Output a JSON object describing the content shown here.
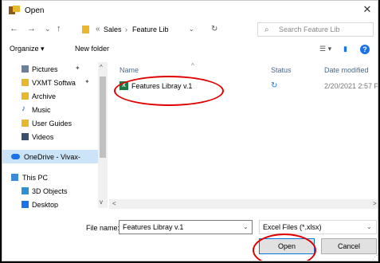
{
  "window": {
    "title": "Open",
    "close": "✕"
  },
  "nav_buttons": {
    "back": "←",
    "forward": "→",
    "dropdown": "⌄",
    "up": "↑",
    "refresh": "↻"
  },
  "address": {
    "overflow": "«",
    "crumbs": [
      "Sales",
      "Feature Lib"
    ],
    "separator": "›"
  },
  "search": {
    "placeholder": "Search Feature Lib"
  },
  "toolbar": {
    "organize": "Organize ▾",
    "new_folder": "New folder"
  },
  "sidebar": {
    "items": [
      {
        "label": "Pictures",
        "pinned": true,
        "icon": "pictures-icon"
      },
      {
        "label": "VXMT Softwa",
        "pinned": true,
        "icon": "folder-icon"
      },
      {
        "label": "Archive",
        "pinned": false,
        "icon": "folder-icon"
      },
      {
        "label": "Music",
        "pinned": false,
        "icon": "music-icon"
      },
      {
        "label": "User Guides",
        "pinned": false,
        "icon": "folder-icon"
      },
      {
        "label": "Videos",
        "pinned": false,
        "icon": "videos-icon"
      },
      {
        "label": "OneDrive - Vivax-",
        "selected": true,
        "icon": "onedrive-icon"
      },
      {
        "label": "This PC",
        "icon": "pc-icon"
      },
      {
        "label": "3D Objects",
        "icon": "3d-objects-icon"
      },
      {
        "label": "Desktop",
        "icon": "desktop-icon"
      }
    ]
  },
  "columns": {
    "name": "Name",
    "status": "Status",
    "date": "Date modified"
  },
  "files": [
    {
      "name": "Features Libray v.1",
      "status_icon": "sync-icon",
      "date": "2/20/2021 2:57 P"
    }
  ],
  "footer": {
    "file_name_label": "File name:",
    "file_name_value": "Features Libray v.1",
    "file_type": "Excel Files (*.xlsx)",
    "open": "Open",
    "cancel": "Cancel"
  },
  "colors": {
    "annotation": "#e00000",
    "accent": "#0078d7",
    "excel": "#1e7a45"
  }
}
